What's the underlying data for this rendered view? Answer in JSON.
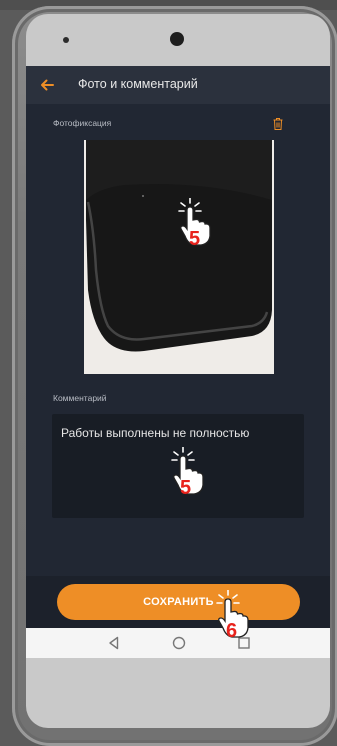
{
  "header": {
    "title": "Фото и комментарий"
  },
  "photo_section": {
    "label": "Фотофиксация"
  },
  "comment_section": {
    "label": "Комментарий",
    "value": "Работы выполнены не полностью"
  },
  "actions": {
    "save_label": "СОХРАНИТЬ"
  },
  "annotations": {
    "step_photo": "5",
    "step_comment": "5",
    "step_save": "6"
  },
  "colors": {
    "accent": "#ee8e26",
    "background": "#212733",
    "header": "#2b313d",
    "step_marker": "#e8221c"
  },
  "icons": {
    "back": "arrow-left-icon",
    "delete": "trash-icon",
    "nav": [
      "nav-back-icon",
      "nav-home-icon",
      "nav-recents-icon"
    ],
    "pointer": "tap-hand-icon"
  }
}
